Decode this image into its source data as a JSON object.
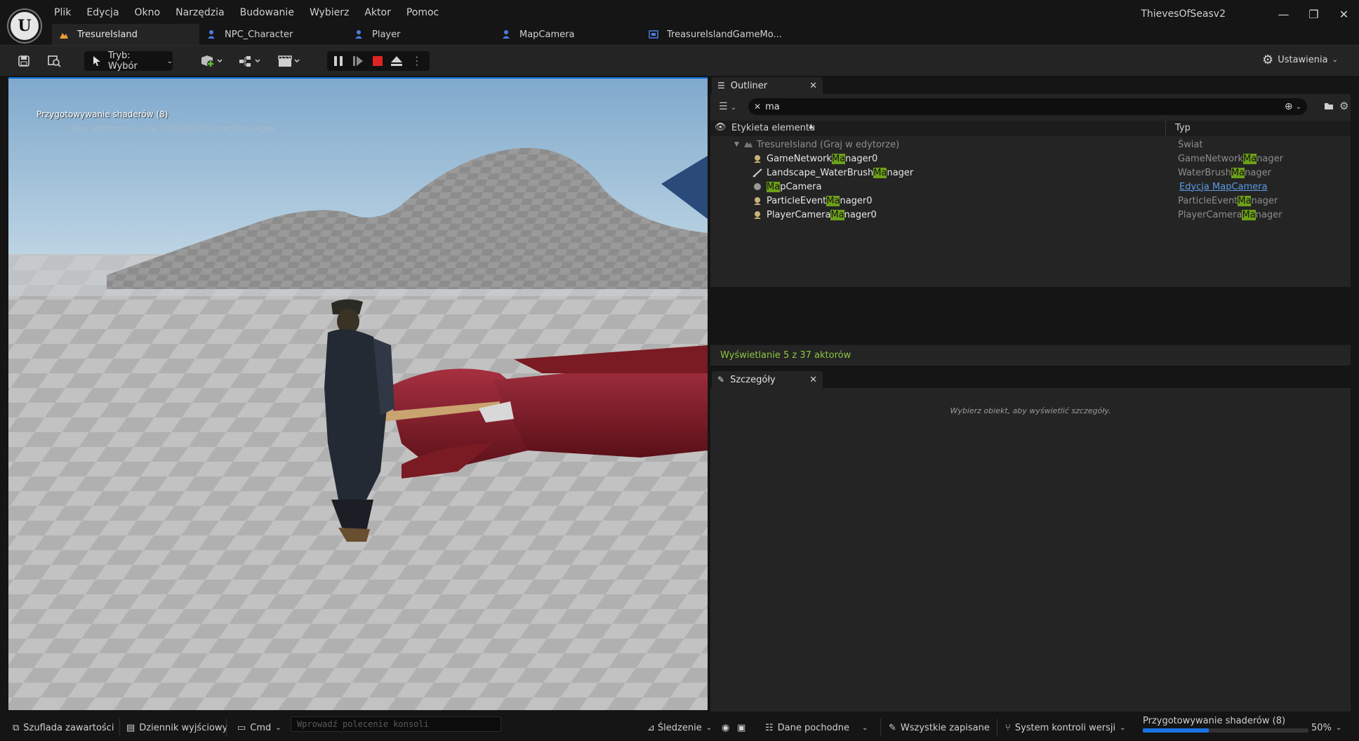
{
  "window": {
    "title": "ThievesOfSeasv2",
    "controls": [
      "—",
      "❐",
      "✕"
    ]
  },
  "menu": [
    "Plik",
    "Edycja",
    "Okno",
    "Narzędzia",
    "Budowanie",
    "Wybierz",
    "Aktor",
    "Pomoc"
  ],
  "tabs": [
    {
      "label": "TresureIsland",
      "icon": "level-icon",
      "active": true
    },
    {
      "label": "NPC_Character",
      "icon": "blueprint-icon",
      "active": false
    },
    {
      "label": "Player",
      "icon": "blueprint-icon",
      "active": false
    },
    {
      "label": "MapCamera",
      "icon": "blueprint-icon",
      "active": false
    },
    {
      "label": "TreasureIslandGameMo...",
      "icon": "widget-icon",
      "active": false
    }
  ],
  "toolbar": {
    "mode_label": "Tryb: Wybór",
    "settings_label": "Ustawienia"
  },
  "viewport": {
    "message": "Przygotowywanie shaderów (8)",
    "hint": "Aby wstrzymać, użyj 'DisableAllScreenMessages'"
  },
  "outliner": {
    "tab_label": "Outliner",
    "search_value": "ma",
    "columns": {
      "label": "Etykieta elementu",
      "type": "Typ"
    },
    "world_row": {
      "label": "TresureIsland (Graj w edytorze)",
      "type": "Świat"
    },
    "rows": [
      {
        "pre": "GameNetwork",
        "hl": "Ma",
        "post": "nager0",
        "type_pre": "GameNetwork",
        "type_hl": "Ma",
        "type_post": "nager"
      },
      {
        "pre": "Landscape_WaterBrush",
        "hl": "Ma",
        "post": "nager",
        "type_pre": "WaterBrush",
        "type_hl": "Ma",
        "type_post": "nager"
      },
      {
        "pre": "",
        "hl": "Ma",
        "post": "pCamera",
        "type_link": "Edycja MapCamera"
      },
      {
        "pre": "ParticleEvent",
        "hl": "Ma",
        "post": "nager0",
        "type_pre": "ParticleEvent",
        "type_hl": "Ma",
        "type_post": "nager"
      },
      {
        "pre": "PlayerCamera",
        "hl": "Ma",
        "post": "nager0",
        "type_pre": "PlayerCamera",
        "type_hl": "Ma",
        "type_post": "nager"
      }
    ],
    "status": "Wyświetlanie 5 z 37 aktorów"
  },
  "details": {
    "tab_label": "Szczegóły",
    "hint": "Wybierz obiekt, aby wyświetlić szczegóły."
  },
  "statusbar": {
    "content_drawer": "Szuflada zawartości",
    "output_log": "Dziennik wyjściowy",
    "cmd": "Cmd",
    "console_placeholder": "Wprowadź polecenie konsoli",
    "tracking": "Śledzenie",
    "derived_data": "Dane pochodne",
    "all_saved": "Wszystkie zapisane",
    "source_control": "System kontroli wersji",
    "shader_progress_label": "Przygotowywanie shaderów (8)",
    "shader_progress": 0.4,
    "zoom": "50%"
  },
  "colors": {
    "accent": "#0a6cdc",
    "highlight": "#6c9f1a",
    "status_green": "#8dc63f",
    "stop_red": "#e02424"
  }
}
